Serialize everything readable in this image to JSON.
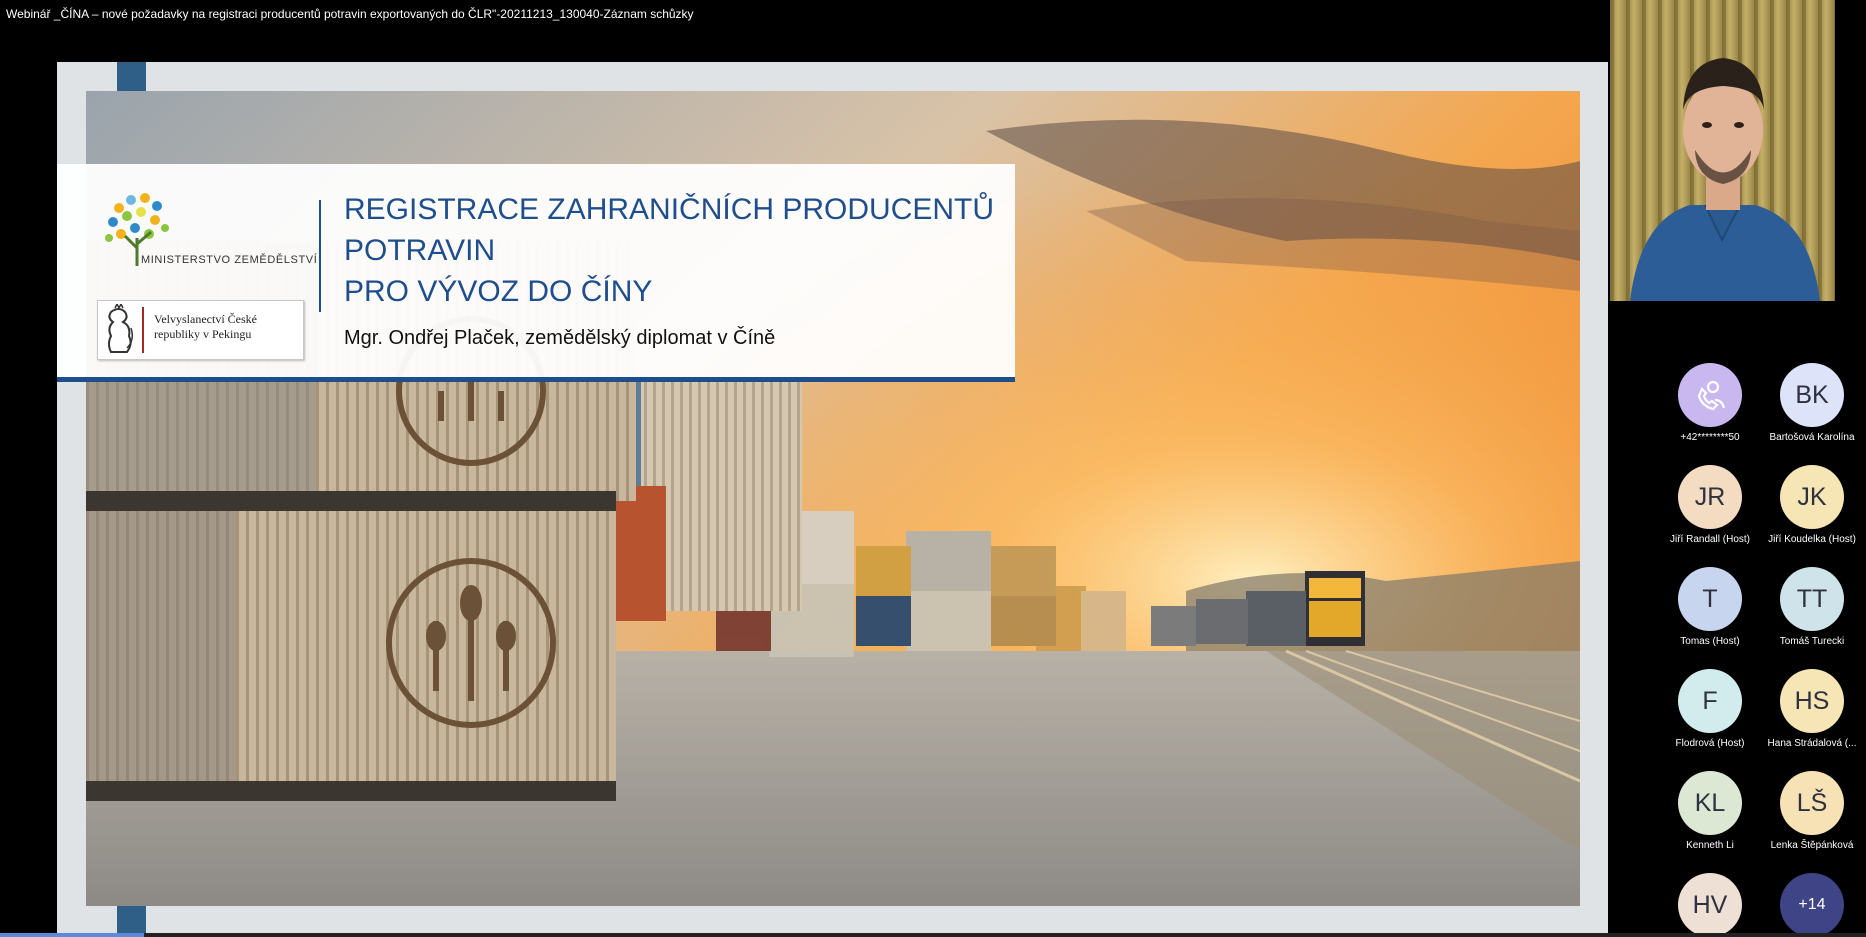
{
  "window": {
    "title": "Webinář _ČÍNA – nové požadavky na registraci producentů potravin exportovaných do ČLR\"-20211213_130040-Záznam schůzky"
  },
  "slide": {
    "title_lines": [
      "REGISTRACE ZAHRANIČNÍCH PRODUCENTŮ",
      "POTRAVIN",
      "PRO VÝVOZ DO ČÍNY"
    ],
    "subtitle": "Mgr. Ondřej Plaček, zemědělský diplomat v Číně",
    "ministry_logo_text": "MINISTERSTVO ZEMĚDĚLSTVÍ",
    "embassy_text": "Velvyslanectví České republiky v Pekingu",
    "title_color": "#1f4e8c"
  },
  "participants": [
    {
      "initials": "",
      "icon": "phone-person-icon",
      "name": "+42********50",
      "color": "#c9b8f0"
    },
    {
      "initials": "BK",
      "name": "Bartošová Karolína",
      "color": "#dde3f8"
    },
    {
      "initials": "JR",
      "name": "Jiří Randall (Host)",
      "color": "#f4dcc3"
    },
    {
      "initials": "JK",
      "name": "Jiří Koudelka (Host)",
      "color": "#f6e6b5"
    },
    {
      "initials": "T",
      "name": "Tomas (Host)",
      "color": "#c7d6ee"
    },
    {
      "initials": "TT",
      "name": "Tomáš Turecki",
      "color": "#cfe3ea"
    },
    {
      "initials": "F",
      "name": "Flodrová (Host)",
      "color": "#d2ecee"
    },
    {
      "initials": "HS",
      "name": "Hana Strádalová (...",
      "color": "#f6e6b5"
    },
    {
      "initials": "KL",
      "name": "Kenneth Li",
      "color": "#dce7d4"
    },
    {
      "initials": "LŠ",
      "name": "Lenka Štěpánková",
      "color": "#f6e2b5"
    },
    {
      "initials": "HV",
      "name": "",
      "color": "#efe0d6"
    },
    {
      "initials": "+14",
      "name": "",
      "color": "#3e4486"
    }
  ],
  "playback": {
    "progress": 0.077
  }
}
